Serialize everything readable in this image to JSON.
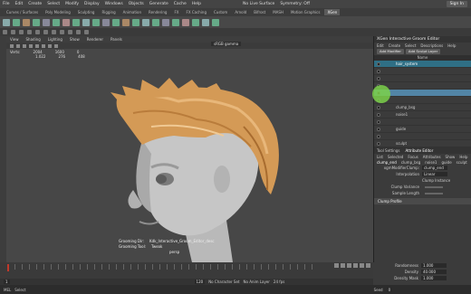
{
  "menubar": {
    "items": [
      "File",
      "Edit",
      "Create",
      "Select",
      "Modify",
      "Display",
      "Windows",
      "Objects",
      "Generate",
      "Cache",
      "Help"
    ],
    "no_live_surface": "No Live Surface",
    "symmetry": "Symmetry: Off",
    "sign_in": "Sign In"
  },
  "shelf": {
    "tabs": [
      "Curves / Surfaces",
      "Poly Modeling",
      "Sculpting",
      "Rigging",
      "Animation",
      "Rendering",
      "FX",
      "FX Caching",
      "Custom",
      "Arnold",
      "Bifrost",
      "MASH",
      "Motion Graphics",
      "XGen"
    ],
    "active_tab": "XGen"
  },
  "viewport": {
    "menu": [
      "View",
      "Shading",
      "Lighting",
      "Show",
      "Renderer",
      "Panels"
    ],
    "renderer": "sRGB gamma",
    "hud_row1": [
      "Verts:",
      "2004",
      "1600",
      "0"
    ],
    "hud_row2": [
      "",
      "1.022",
      "276",
      "408"
    ],
    "hud_bottom": [
      {
        "label": "Grooming Dir:",
        "value": "Kdk_Interactive_Groom_Editor_desc"
      },
      {
        "label": "Grooming Tool:",
        "value": "Tweak"
      }
    ],
    "hud_label": "persp"
  },
  "xgen_editor": {
    "title": "XGen Interactive Groom Editor",
    "menu": [
      "Edit",
      "Create",
      "Select",
      "Descriptions",
      "Help"
    ],
    "buttons": [
      "Add Modifier",
      "Add Sculpt Layer"
    ],
    "column": "Name",
    "rows": [
      {
        "label": "hair_system",
        "state": "hl"
      },
      {
        "label": "",
        "state": ""
      },
      {
        "label": "",
        "state": ""
      },
      {
        "label": "",
        "state": ""
      },
      {
        "label": "",
        "state": "sel"
      },
      {
        "label": "",
        "state": ""
      },
      {
        "label": "clump_bsg",
        "state": ""
      },
      {
        "label": "noise1",
        "state": ""
      },
      {
        "label": "",
        "state": ""
      },
      {
        "label": "guide",
        "state": ""
      },
      {
        "label": "",
        "state": ""
      },
      {
        "label": "sculpt",
        "state": ""
      }
    ]
  },
  "attribute_editor": {
    "tabs_top": [
      "Tool Settings",
      "Attribute Editor"
    ],
    "menu": [
      "List",
      "Selected",
      "Focus",
      "Attributes",
      "Show",
      "Help"
    ],
    "node_tabs": [
      "clump_end",
      "clump_bsg",
      "noise1",
      "guide",
      "sculpt"
    ],
    "node_name": "clump_end",
    "fields": [
      {
        "label": "xgmModifierClump:",
        "value": "clump_end"
      },
      {
        "label": "Interpolation",
        "value": "Linear"
      },
      {
        "label": "Clump Variance",
        "value": ""
      },
      {
        "label": "Sample Length",
        "value": ""
      }
    ],
    "checkbox": "Clump Instance",
    "section": "Clump Profile",
    "profile": [
      {
        "label": "Randomness",
        "value": "1.000"
      },
      {
        "label": "Density",
        "value": "40.000"
      },
      {
        "label": "Density Mask",
        "value": "1.000"
      },
      {
        "label": "Seed",
        "value": "0"
      }
    ]
  },
  "timeline": {
    "start": "1",
    "end": "120",
    "no_char_set": "No Character Set",
    "no_anim_layer": "No Anim Layer",
    "fps": "24 fps"
  },
  "status": {
    "mel": "MEL",
    "select_note": "Select"
  },
  "colors": {
    "accent": "#5285a6",
    "highlight": "#2f6f85",
    "cursor": "#7bd14a",
    "hair": "#d49a56"
  }
}
